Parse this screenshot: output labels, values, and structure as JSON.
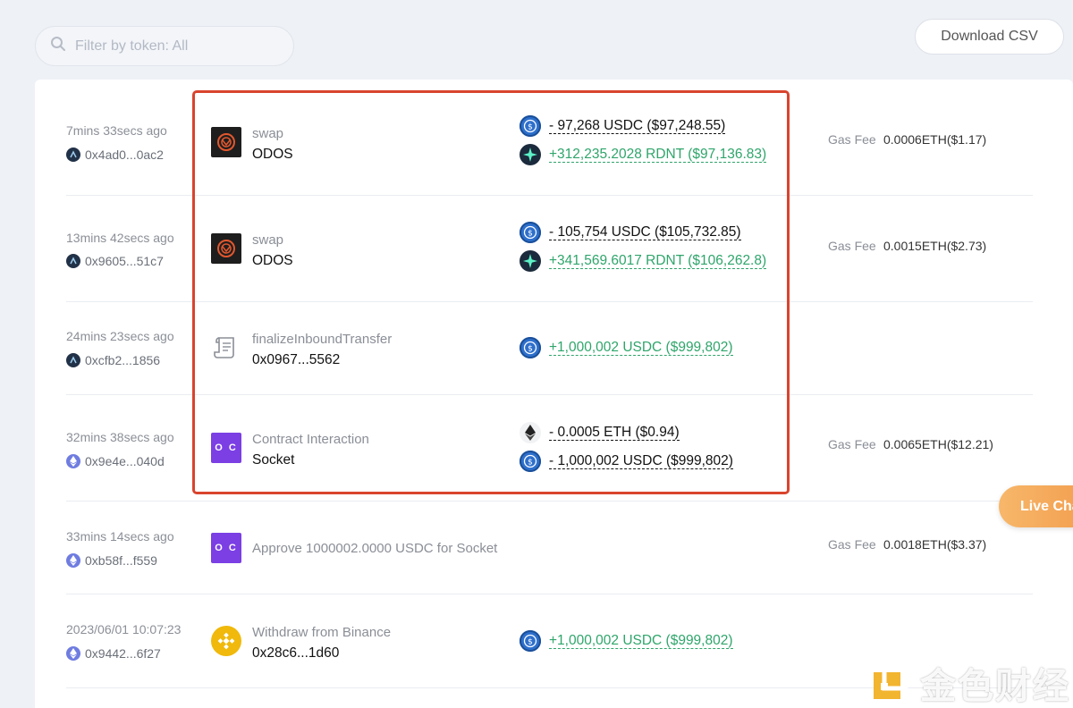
{
  "filter": {
    "placeholder": "Filter by token: All"
  },
  "toolbar": {
    "download_label": "Download CSV"
  },
  "gas_label": "Gas Fee",
  "rows": [
    {
      "time": "7mins 33secs ago",
      "address": "0x4ad0...0ac2",
      "chain": "arbitrum",
      "protocol_icon": "odos-icon",
      "method": "swap",
      "target": "ODOS",
      "transfers": [
        {
          "token": "usdc-icon",
          "amount": "- 97,268 USDC ($97,248.55)",
          "direction": "out"
        },
        {
          "token": "rdnt-icon",
          "amount": "+312,235.2028 RDNT ($97,136.83)",
          "direction": "in"
        }
      ],
      "gas_fee": "0.0006ETH($1.17)"
    },
    {
      "time": "13mins 42secs ago",
      "address": "0x9605...51c7",
      "chain": "arbitrum",
      "protocol_icon": "odos-icon",
      "method": "swap",
      "target": "ODOS",
      "transfers": [
        {
          "token": "usdc-icon",
          "amount": "- 105,754 USDC ($105,732.85)",
          "direction": "out"
        },
        {
          "token": "rdnt-icon",
          "amount": "+341,569.6017 RDNT ($106,262.8)",
          "direction": "in"
        }
      ],
      "gas_fee": "0.0015ETH($2.73)"
    },
    {
      "time": "24mins 23secs ago",
      "address": "0xcfb2...1856",
      "chain": "arbitrum",
      "protocol_icon": "scroll-icon",
      "method": "finalizeInboundTransfer",
      "target": "0x0967...5562",
      "transfers": [
        {
          "token": "usdc-icon",
          "amount": "+1,000,002 USDC ($999,802)",
          "direction": "in"
        }
      ],
      "gas_fee": ""
    },
    {
      "time": "32mins 38secs ago",
      "address": "0x9e4e...040d",
      "chain": "ethereum",
      "protocol_icon": "socket-icon",
      "method": "Contract Interaction",
      "target": "Socket",
      "transfers": [
        {
          "token": "eth-icon",
          "amount": "- 0.0005 ETH ($0.94)",
          "direction": "out"
        },
        {
          "token": "usdc-icon",
          "amount": "- 1,000,002 USDC ($999,802)",
          "direction": "out"
        }
      ],
      "gas_fee": "0.0065ETH($12.21)"
    },
    {
      "time": "33mins 14secs ago",
      "address": "0xb58f...f559",
      "chain": "ethereum",
      "protocol_icon": "socket-icon",
      "method": "Approve 1000002.0000 USDC for Socket",
      "target": "",
      "transfers": [],
      "gas_fee": "0.0018ETH($3.37)"
    },
    {
      "time": "2023/06/01 10:07:23",
      "address": "0x9442...6f27",
      "chain": "ethereum",
      "protocol_icon": "binance-icon",
      "method": "Withdraw from Binance",
      "target": "0x28c6...1d60",
      "transfers": [
        {
          "token": "usdc-icon",
          "amount": "+1,000,002 USDC ($999,802)",
          "direction": "in"
        }
      ],
      "gas_fee": ""
    }
  ],
  "live_chat": {
    "label": "Live Chat"
  },
  "watermark": {
    "text": "金色财经"
  },
  "colors": {
    "positive": "#2fa56b",
    "highlight": "#d9442e",
    "background": "#eef1f6"
  }
}
